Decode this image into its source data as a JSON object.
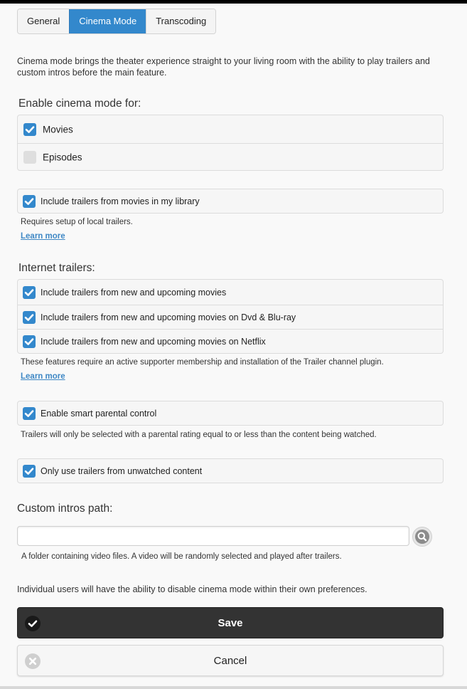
{
  "tabs": [
    {
      "label": "General",
      "active": false
    },
    {
      "label": "Cinema Mode",
      "active": true
    },
    {
      "label": "Transcoding",
      "active": false
    }
  ],
  "intro": "Cinema mode brings the theater experience straight to your living room with the ability to play trailers and custom intros before the main feature.",
  "enable_section": {
    "heading": "Enable cinema mode for:",
    "items": [
      {
        "label": "Movies",
        "checked": true
      },
      {
        "label": "Episodes",
        "checked": false
      }
    ]
  },
  "local_trailers": {
    "label": "Include trailers from movies in my library",
    "checked": true,
    "note": "Requires setup of local trailers.",
    "learn_more": "Learn more"
  },
  "internet_trailers": {
    "heading": "Internet trailers:",
    "items": [
      {
        "label": "Include trailers from new and upcoming movies",
        "checked": true
      },
      {
        "label": "Include trailers from new and upcoming movies on Dvd & Blu-ray",
        "checked": true
      },
      {
        "label": "Include trailers from new and upcoming movies on Netflix",
        "checked": true
      }
    ],
    "note": "These features require an active supporter membership and installation of the Trailer channel plugin.",
    "learn_more": "Learn more"
  },
  "parental": {
    "label": "Enable smart parental control",
    "checked": true,
    "note": "Trailers will only be selected with a parental rating equal to or less than the content being watched."
  },
  "unwatched": {
    "label": "Only use trailers from unwatched content",
    "checked": true
  },
  "custom_intros": {
    "heading": "Custom intros path:",
    "value": "",
    "note": "A folder containing video files. A video will be randomly selected and played after trailers."
  },
  "footer_note": "Individual users will have the ability to disable cinema mode within their own preferences.",
  "buttons": {
    "save": "Save",
    "cancel": "Cancel"
  },
  "colors": {
    "accent": "#3388cc",
    "save_bg": "#333333",
    "link": "#3f88c5"
  }
}
